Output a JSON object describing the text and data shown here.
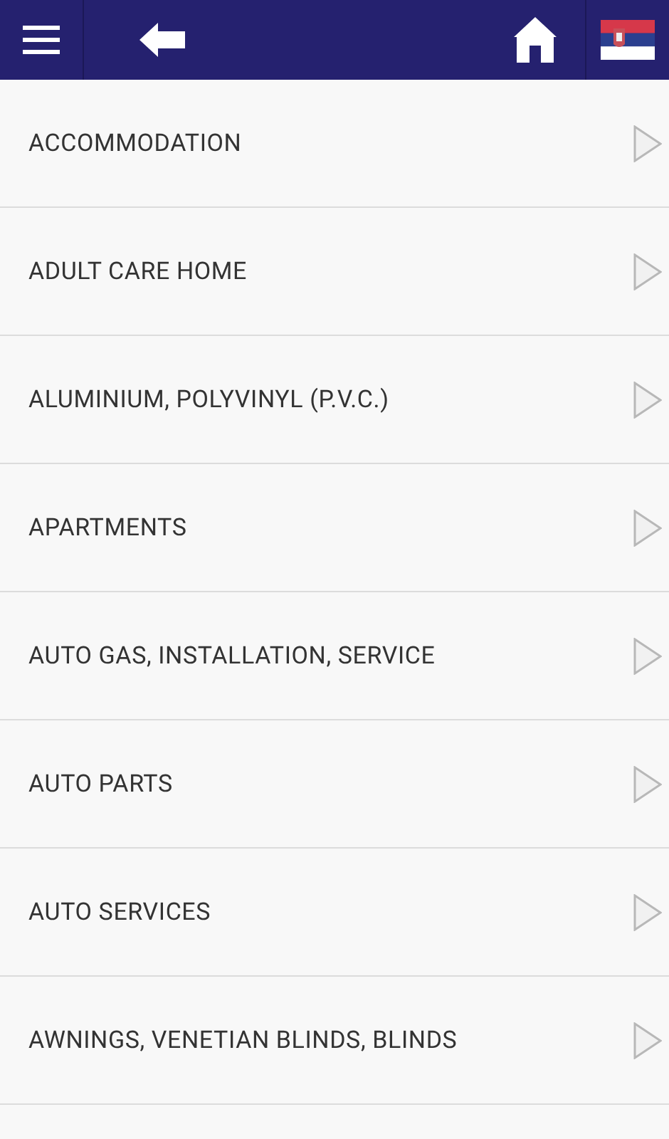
{
  "categories": [
    {
      "label": "ACCOMMODATION"
    },
    {
      "label": "ADULT CARE HOME"
    },
    {
      "label": "ALUMINIUM, POLYVINYL (P.V.C.)"
    },
    {
      "label": "APARTMENTS"
    },
    {
      "label": "AUTO GAS, INSTALLATION, SERVICE"
    },
    {
      "label": "AUTO PARTS"
    },
    {
      "label": "AUTO SERVICES"
    },
    {
      "label": "AWNINGS, VENETIAN BLINDS, BLINDS"
    }
  ]
}
